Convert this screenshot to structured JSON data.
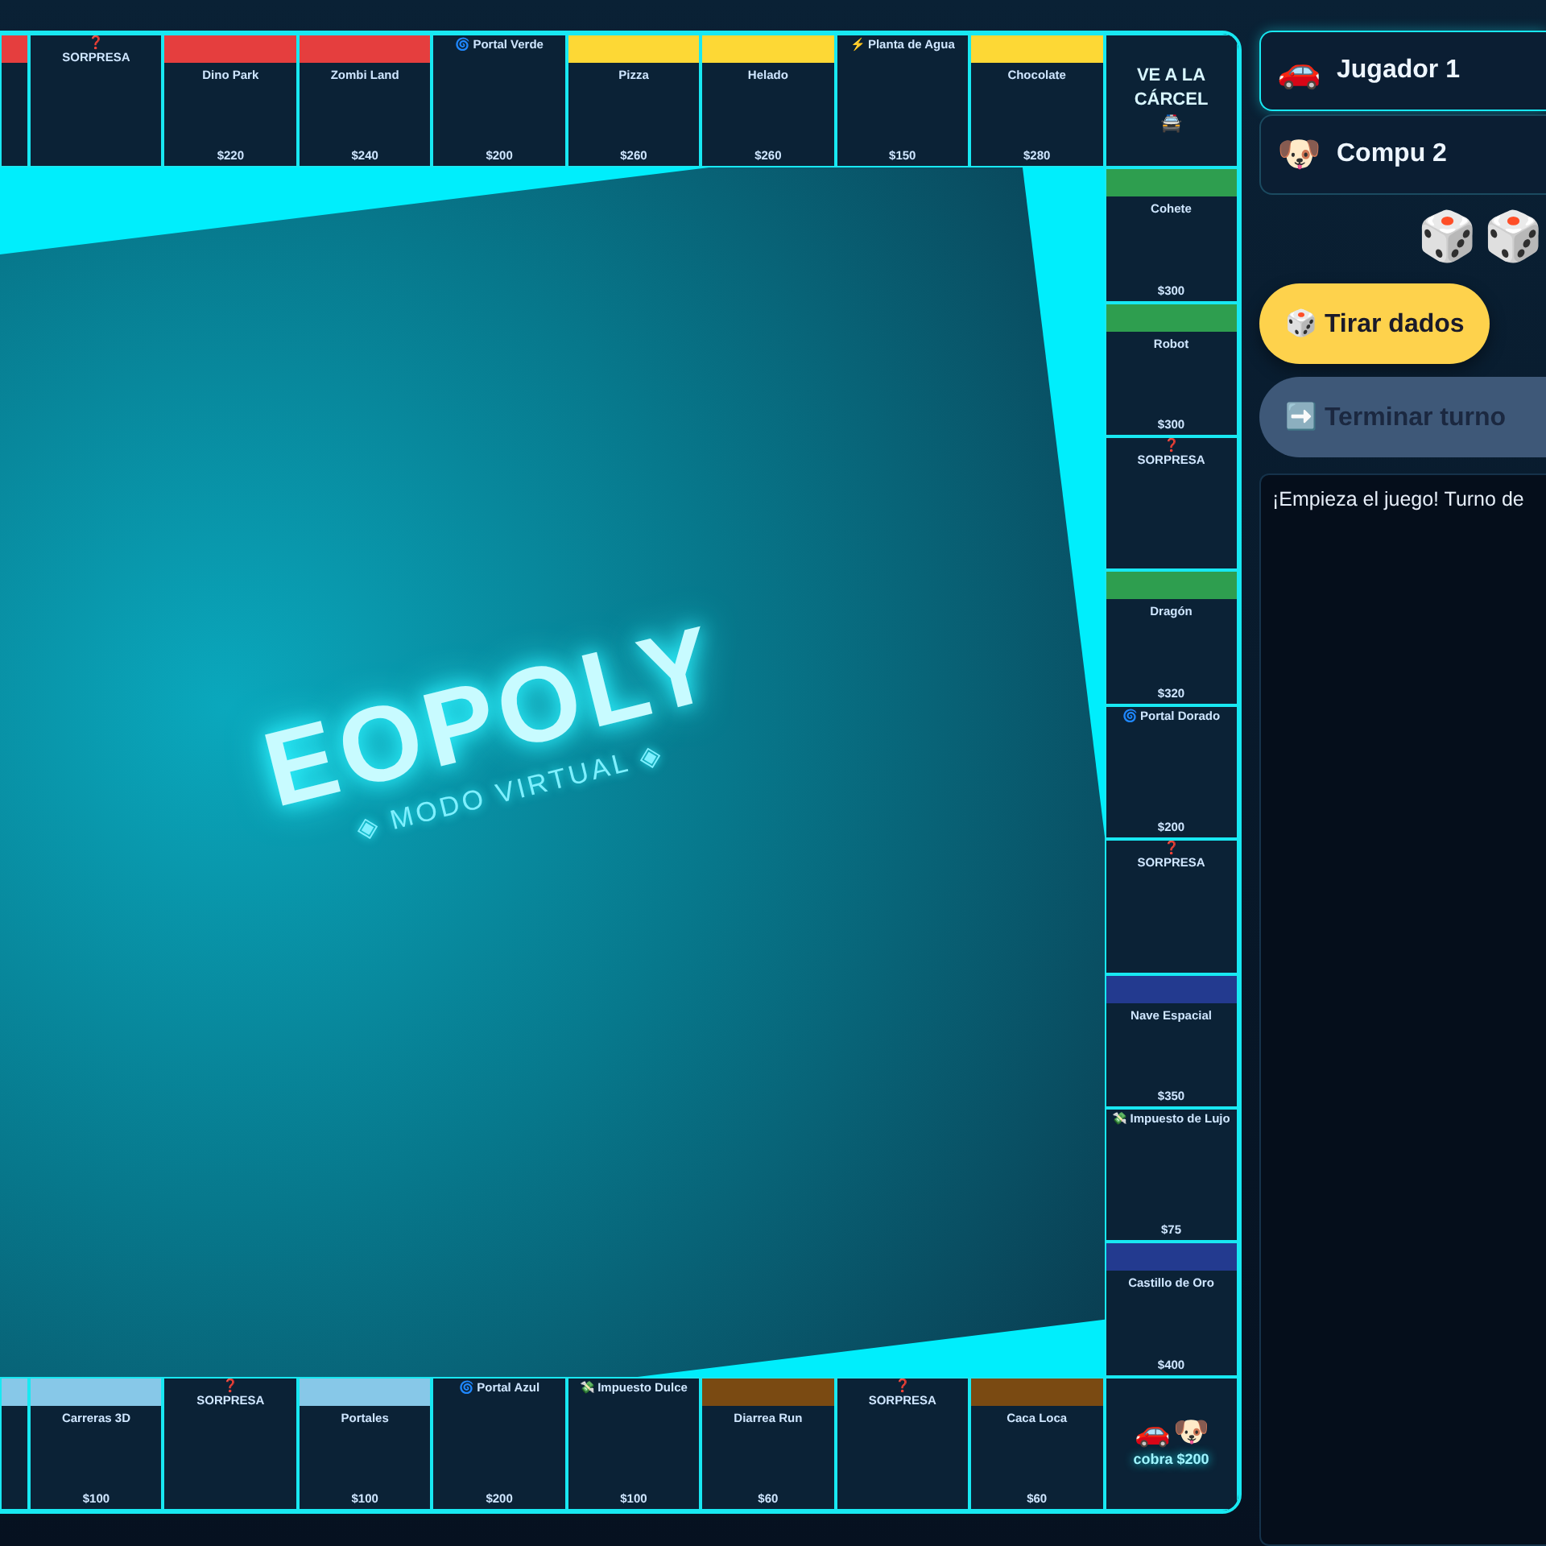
{
  "board": {
    "top_row": [
      {
        "kind": "property",
        "color": "#e53e3e"
      },
      {
        "kind": "chance",
        "icon": "❓",
        "name": "SORPRESA"
      },
      {
        "kind": "property",
        "color": "#e53e3e",
        "name": "Dino Park",
        "price": "$220"
      },
      {
        "kind": "property",
        "color": "#e53e3e",
        "name": "Zombi Land",
        "price": "$240"
      },
      {
        "kind": "portal",
        "icon": "🌀",
        "name": "Portal Verde",
        "price": "$200"
      },
      {
        "kind": "property",
        "color": "#fdd835",
        "name": "Pizza",
        "price": "$260"
      },
      {
        "kind": "property",
        "color": "#fdd835",
        "name": "Helado",
        "price": "$260"
      },
      {
        "kind": "utility",
        "icon": "⚡",
        "name": "Planta de Agua",
        "price": "$150"
      },
      {
        "kind": "property",
        "color": "#fdd835",
        "name": "Chocolate",
        "price": "$280"
      },
      {
        "kind": "jail",
        "name": "VE A LA CÁRCEL 🚔"
      }
    ],
    "right_column": [
      {
        "kind": "property",
        "color": "#2e9e4f",
        "name": "Cohete",
        "price": "$300"
      },
      {
        "kind": "property",
        "color": "#2e9e4f",
        "name": "Robot",
        "price": "$300"
      },
      {
        "kind": "chance",
        "icon": "❓",
        "name": "SORPRESA"
      },
      {
        "kind": "property",
        "color": "#2e9e4f",
        "name": "Dragón",
        "price": "$320"
      },
      {
        "kind": "portal",
        "icon": "🌀",
        "name": "Portal Dorado",
        "price": "$200"
      },
      {
        "kind": "chance",
        "icon": "❓",
        "name": "SORPRESA"
      },
      {
        "kind": "property",
        "color": "#233a8f",
        "name": "Nave Espacial",
        "price": "$350"
      },
      {
        "kind": "tax",
        "icon": "💸",
        "name": "Impuesto de Lujo",
        "price": "$75"
      },
      {
        "kind": "property",
        "color": "#233a8f",
        "name": "Castillo de Oro",
        "price": "$400"
      }
    ],
    "bottom_row": [
      {
        "kind": "property",
        "color": "#87c8e8"
      },
      {
        "kind": "property",
        "color": "#87c8e8",
        "name": "Carreras 3D",
        "price": "$100"
      },
      {
        "kind": "chance",
        "icon": "❓",
        "name": "SORPRESA"
      },
      {
        "kind": "property",
        "color": "#87c8e8",
        "name": "Portales",
        "price": "$100"
      },
      {
        "kind": "portal",
        "icon": "🌀",
        "name": "Portal Azul",
        "price": "$200"
      },
      {
        "kind": "tax",
        "icon": "💸",
        "name": "Impuesto Dulce",
        "price": "$100"
      },
      {
        "kind": "property",
        "color": "#7a4a12",
        "name": "Diarrea Run",
        "price": "$60"
      },
      {
        "kind": "chance",
        "icon": "❓",
        "name": "SORPRESA"
      },
      {
        "kind": "property",
        "color": "#7a4a12",
        "name": "Caca Loca",
        "price": "$60"
      },
      {
        "kind": "go",
        "tokens": [
          "🚗",
          "🐶"
        ],
        "name": "cobra $200"
      }
    ],
    "logo": {
      "title": "EOPOLY",
      "subtitle": "◈ MODO VIRTUAL ◈"
    }
  },
  "players": [
    {
      "token": "🚗",
      "name": "Jugador 1",
      "selected": true
    },
    {
      "token": "🐶",
      "name": "Compu 2",
      "selected": false
    }
  ],
  "dice": [
    "🎲",
    "🎲"
  ],
  "buttons": [
    {
      "icon": "🎲",
      "label": "Tirar dados",
      "disabled": false
    },
    {
      "icon": "➡️",
      "label": "Terminar turno",
      "disabled": true
    }
  ],
  "log": [
    "¡Empieza el juego! Turno de"
  ]
}
